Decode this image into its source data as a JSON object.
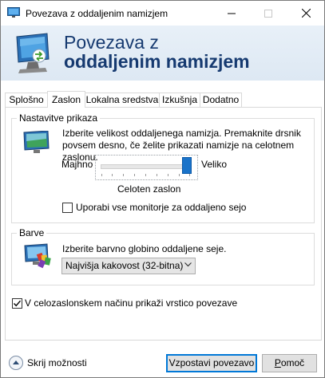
{
  "window": {
    "title": "Povezava z oddaljenim namizjem"
  },
  "banner": {
    "line1": "Povezava z",
    "line2": "oddaljenim namizjem"
  },
  "tabs": [
    {
      "label": "Splošno",
      "active": false
    },
    {
      "label": "Zaslon",
      "active": true
    },
    {
      "label": "Lokalna sredstva",
      "active": false
    },
    {
      "label": "Izkušnja",
      "active": false
    },
    {
      "label": "Dodatno",
      "active": false
    }
  ],
  "display_config": {
    "legend": "Nastavitve prikaza",
    "description": "Izberite velikost oddaljenega namizja. Premaknite drsnik povsem desno, če želite prikazati namizje na celotnem zaslonu.",
    "slider_min_label": "Majhno",
    "slider_max_label": "Veliko",
    "slider_value_label": "Celoten zaslon",
    "slider_level": 1.0,
    "use_all_monitors_label": "Uporabi vse monitorje za oddaljeno sejo",
    "use_all_monitors_checked": false
  },
  "colors": {
    "legend": "Barve",
    "description": "Izberite barvno globino oddaljene seje.",
    "depth_selected": "Najvišja kakovost (32-bitna)"
  },
  "fullscreen_bar": {
    "label": "V celozaslonskem načinu prikaži vrstico povezave",
    "checked": true
  },
  "footer": {
    "hide_options_label": "Skrij možnosti",
    "connect_label": "Vzpostavi povezavo",
    "help_label": "Pomoč"
  },
  "accent": "#0078d7",
  "banner_text_color": "#163a70"
}
